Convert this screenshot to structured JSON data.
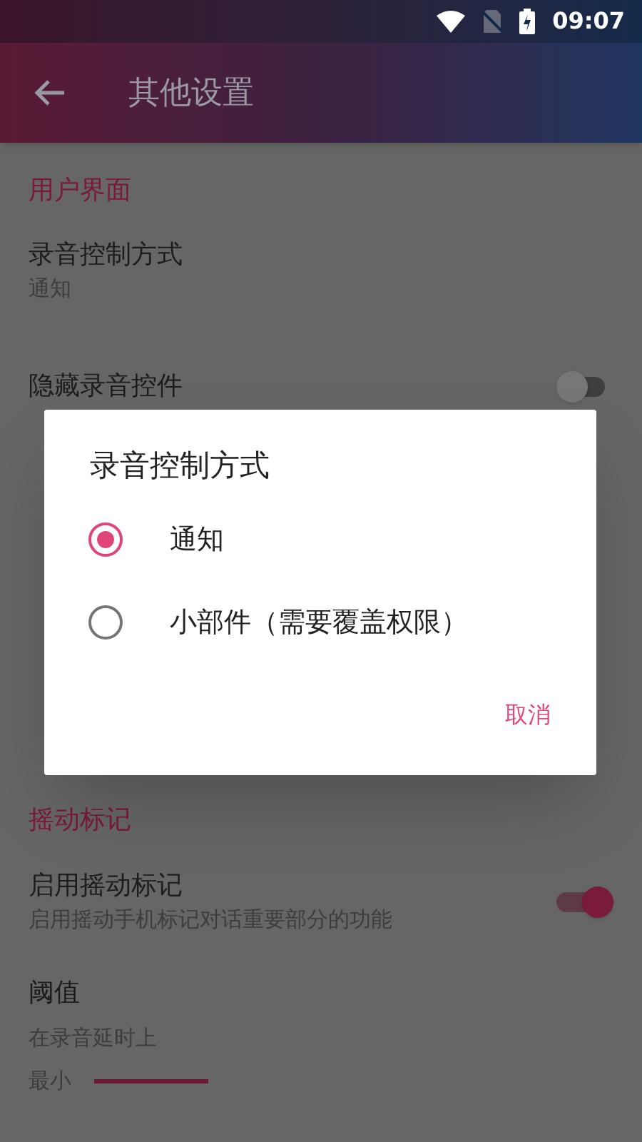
{
  "status_bar": {
    "time": "09:07"
  },
  "app_bar": {
    "title": "其他设置"
  },
  "sections": [
    {
      "title": "用户界面",
      "items": [
        {
          "kind": "text",
          "title": "录音控制方式",
          "subtitle": "通知"
        },
        {
          "kind": "switch",
          "title": "隐藏录音控件",
          "on": false
        }
      ]
    },
    {
      "title": "摇动标记",
      "items": [
        {
          "kind": "switch",
          "title": "启用摇动标记",
          "subtitle": "启用摇动手机标记对话重要部分的功能",
          "on": true
        },
        {
          "kind": "slider",
          "title": "阈值",
          "subtitle": "在录音延时上",
          "min_label": "最小"
        }
      ]
    }
  ],
  "dialog": {
    "title": "录音控制方式",
    "options": [
      {
        "label": "通知",
        "selected": true
      },
      {
        "label": "小部件（需要覆盖权限）",
        "selected": false
      }
    ],
    "button": "取消"
  }
}
